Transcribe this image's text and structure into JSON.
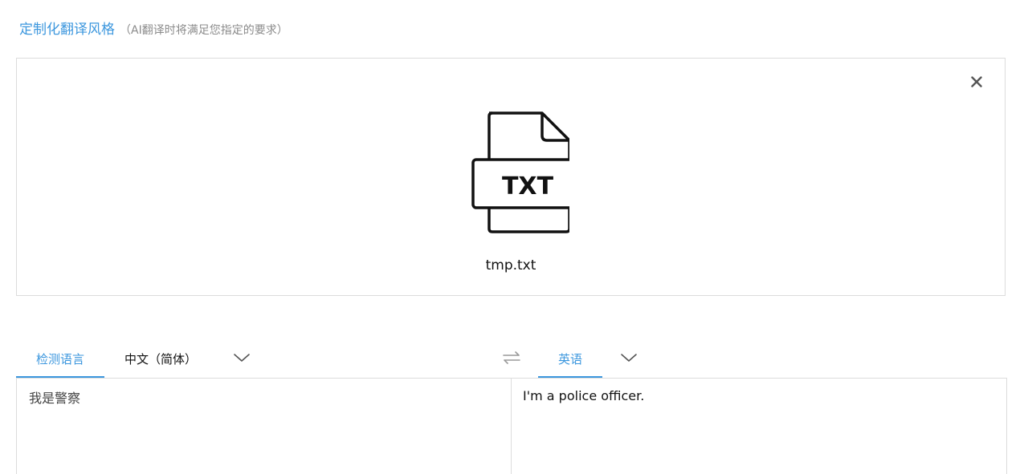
{
  "header": {
    "title": "定制化翻译风格",
    "subtitle": "（AI翻译时将满足您指定的要求）"
  },
  "upload": {
    "file_type_label": "TXT",
    "file_name": "tmp.txt",
    "close_icon": "close-icon",
    "file_icon": "txt-file-icon"
  },
  "languages": {
    "detect_tab_label": "检测语言",
    "source_language": "中文（简体）",
    "target_language": "英语",
    "swap_icon": "swap-icon",
    "dropdown_icon": "chevron-down-icon"
  },
  "translation": {
    "source_text": "我是警察",
    "target_text": "I'm a police officer."
  },
  "colors": {
    "accent": "#3c97de",
    "border": "#dcdcdc",
    "muted_text": "#8b8b8b"
  }
}
